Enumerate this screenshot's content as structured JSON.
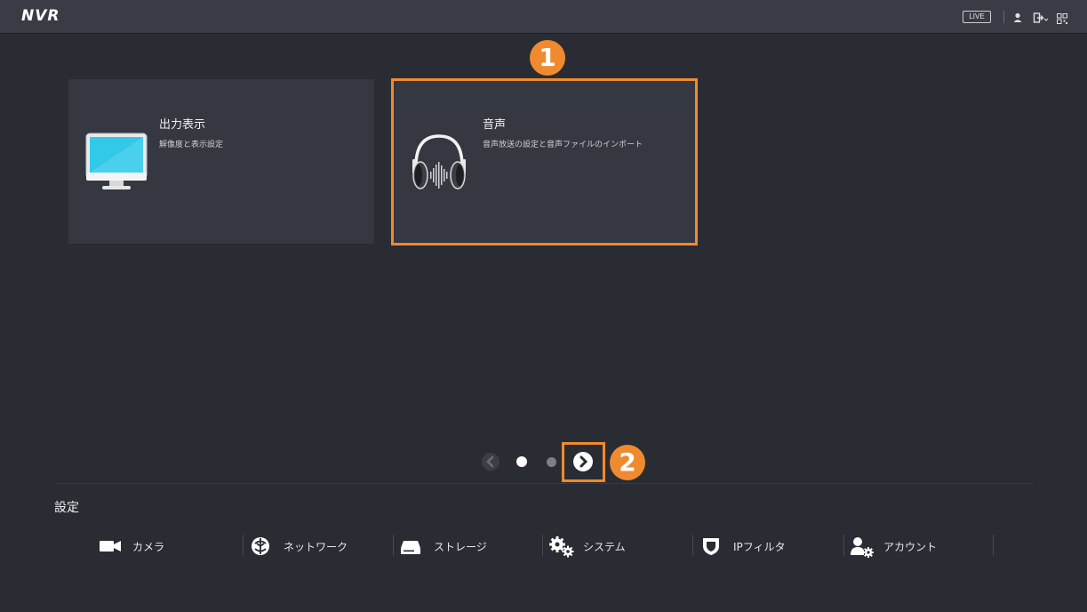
{
  "header": {
    "logo": "NVR",
    "live_label": "LIVE",
    "icons": [
      "user-icon",
      "logout-icon",
      "qr-code-icon"
    ]
  },
  "cards": [
    {
      "title": "出力表示",
      "description": "解像度と表示設定",
      "icon": "monitor-icon"
    },
    {
      "title": "音声",
      "description": "音声放送の設定と音声ファイルのインポート",
      "icon": "headphones-icon"
    }
  ],
  "annotations": {
    "badge1": "1",
    "badge2": "2",
    "highlight_color": "#ef8a2f"
  },
  "pager": {
    "total_pages": 2,
    "current_page": 1
  },
  "settings": {
    "title": "設定",
    "items": [
      {
        "label": "カメラ",
        "icon": "camera-icon"
      },
      {
        "label": "ネットワーク",
        "icon": "network-icon"
      },
      {
        "label": "ストレージ",
        "icon": "storage-icon"
      },
      {
        "label": "システム",
        "icon": "gears-icon"
      },
      {
        "label": "IPフィルタ",
        "icon": "shield-icon"
      },
      {
        "label": "アカウント",
        "icon": "account-icon"
      }
    ]
  }
}
